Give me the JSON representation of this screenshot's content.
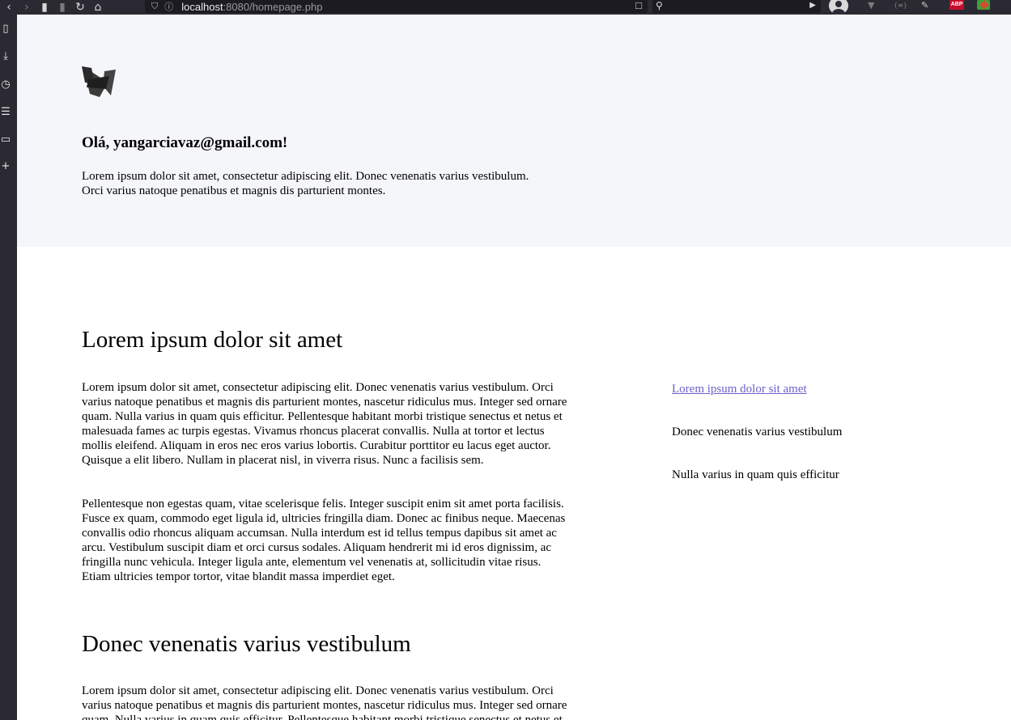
{
  "browser": {
    "url_host": "localhost",
    "url_rest": ":8080/homepage.php",
    "extensions": {
      "abp_label": "ABP",
      "json_label": "{≡}"
    }
  },
  "hero": {
    "greeting": "Olá, yangarciavaz@gmail.com!",
    "intro_line1": "Lorem ipsum dolor sit amet, consectetur adipiscing elit. Donec venenatis varius vestibulum.",
    "intro_line2": "Orci varius natoque penatibus et magnis dis parturient montes."
  },
  "main": {
    "section1_title": "Lorem ipsum dolor sit amet",
    "section1_para1": "Lorem ipsum dolor sit amet, consectetur adipiscing elit. Donec venenatis varius vestibulum. Orci varius natoque penatibus et magnis dis parturient montes, nascetur ridiculus mus. Integer sed ornare quam. Nulla varius in quam quis efficitur. Pellentesque habitant morbi tristique senectus et netus et malesuada fames ac turpis egestas. Vivamus rhoncus placerat convallis. Nulla at tortor et lectus mollis eleifend. Aliquam in eros nec eros varius lobortis. Curabitur porttitor eu lacus eget auctor. Quisque a elit libero. Nullam in placerat nisl, in viverra risus. Nunc a facilisis sem.",
    "section1_para2": "Pellentesque non egestas quam, vitae scelerisque felis. Integer suscipit enim sit amet porta facilisis. Fusce ex quam, commodo eget ligula id, ultricies fringilla diam. Donec ac finibus neque. Maecenas convallis odio rhoncus aliquam accumsan. Nulla interdum est id tellus tempus dapibus sit amet ac arcu. Vestibulum suscipit diam et orci cursus sodales. Aliquam hendrerit mi id eros dignissim, ac fringilla nunc vehicula. Integer ligula ante, elementum vel venenatis at, sollicitudin vitae risus. Etiam ultricies tempor tortor, vitae blandit massa imperdiet eget.",
    "section2_title": "Donec venenatis varius vestibulum",
    "section2_para1": "Lorem ipsum dolor sit amet, consectetur adipiscing elit. Donec venenatis varius vestibulum. Orci varius natoque penatibus et magnis dis parturient montes, nascetur ridiculus mus. Integer sed ornare quam. Nulla varius in quam quis efficitur. Pellentesque habitant morbi tristique senectus et netus et malesuada fames ac turpis egestas."
  },
  "aside": {
    "link1": "Lorem ipsum dolor sit amet",
    "item2": "Donec venenatis varius vestibulum",
    "item3": "Nulla varius in quam quis efficitur"
  },
  "colors": {
    "hero_bg": "#f5f6fa",
    "link": "#6b63c9",
    "browser_chrome": "#2b2a33"
  },
  "icons": {
    "toolbar": [
      "back-icon",
      "forward-icon",
      "reader-icon",
      "bookmark-flag-icon",
      "reload-icon",
      "home-icon"
    ],
    "sidebar": [
      "bookmarks-icon",
      "downloads-icon",
      "history-icon",
      "reading-list-icon",
      "tabs-icon",
      "add-panel-icon"
    ]
  }
}
